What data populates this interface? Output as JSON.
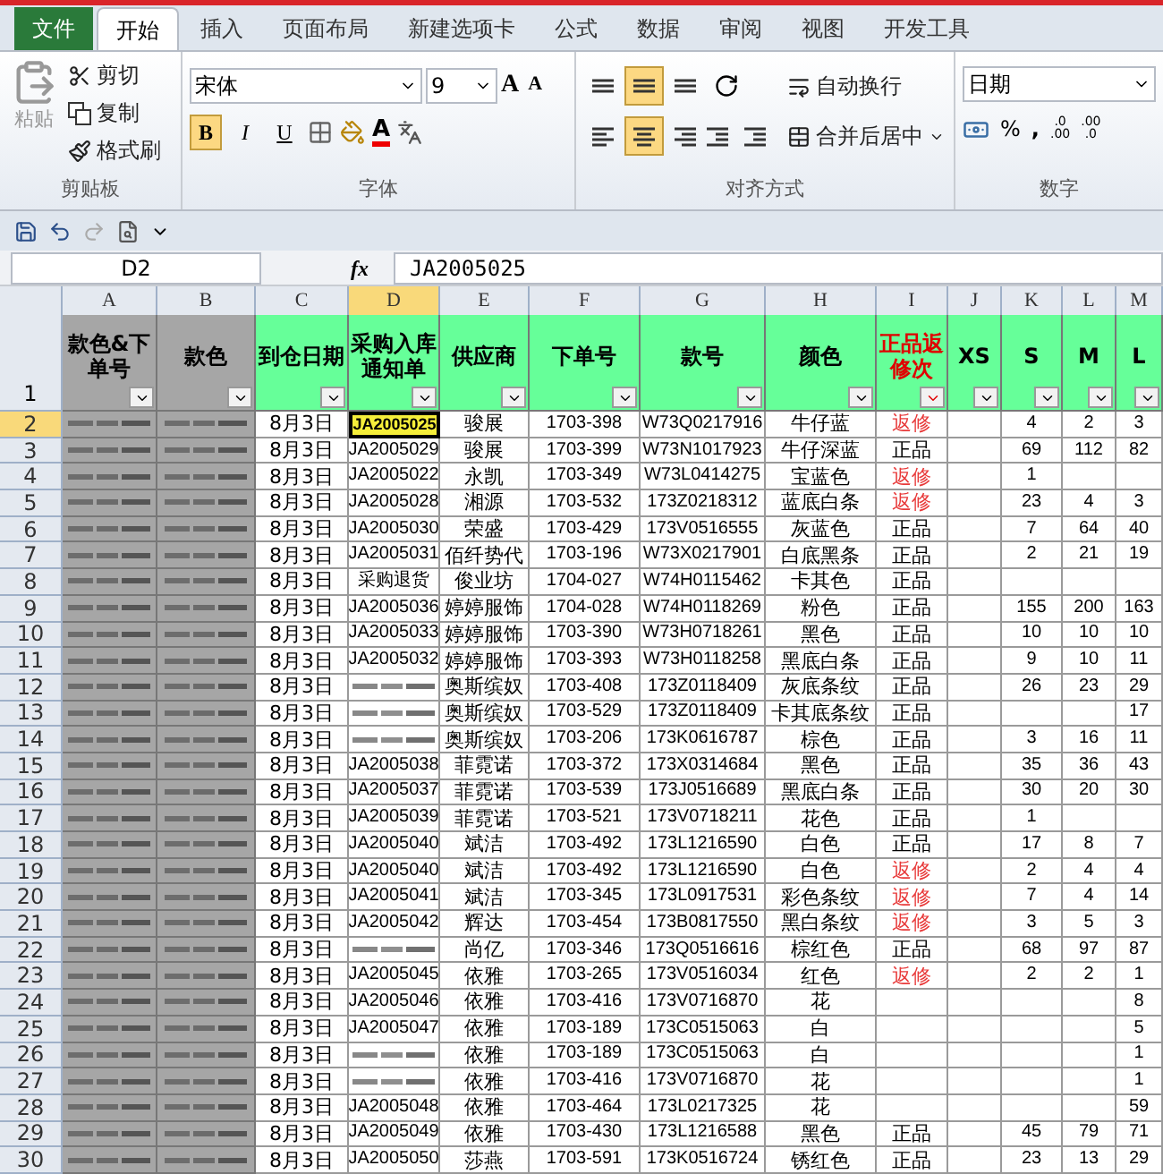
{
  "tabs": [
    {
      "label": "文件",
      "kind": "file",
      "selected": false
    },
    {
      "label": "开始",
      "kind": "tab",
      "selected": true
    },
    {
      "label": "插入",
      "kind": "tab",
      "selected": false
    },
    {
      "label": "页面布局",
      "kind": "tab",
      "selected": false
    },
    {
      "label": "新建选项卡",
      "kind": "tab",
      "selected": false
    },
    {
      "label": "公式",
      "kind": "tab",
      "selected": false
    },
    {
      "label": "数据",
      "kind": "tab",
      "selected": false
    },
    {
      "label": "审阅",
      "kind": "tab",
      "selected": false
    },
    {
      "label": "视图",
      "kind": "tab",
      "selected": false
    },
    {
      "label": "开发工具",
      "kind": "tab",
      "selected": false
    }
  ],
  "ribbon": {
    "clipboard": {
      "title": "剪贴板",
      "paste": "粘贴",
      "cut": "剪切",
      "copy": "复制",
      "painter": "格式刷"
    },
    "font": {
      "title": "字体",
      "family": "宋体",
      "size": "9",
      "grow": "A",
      "shrink": "A",
      "font_color": "A",
      "styles": [
        {
          "kind": "bold",
          "label": "B",
          "on": true
        },
        {
          "kind": "italic",
          "label": "I",
          "on": false
        },
        {
          "kind": "underline",
          "label": "U",
          "on": false
        }
      ]
    },
    "alignment": {
      "title": "对齐方式",
      "wrap": "自动换行",
      "merge": "合并后居中",
      "buttons": [
        {
          "kind": "top",
          "on": false
        },
        {
          "kind": "middle",
          "on": true
        },
        {
          "kind": "bottom",
          "on": false
        },
        {
          "kind": "left",
          "on": false
        },
        {
          "kind": "center",
          "on": true
        },
        {
          "kind": "right",
          "on": false
        }
      ]
    },
    "number": {
      "title": "数字",
      "format": "日期",
      "percent": "%",
      "comma": ",",
      "increase_decimal": [
        ".0",
        ".00"
      ],
      "decrease_decimal": [
        ".00",
        ".0"
      ]
    }
  },
  "formula_bar": {
    "name_box": "D2",
    "fx": "fx",
    "value": "JA2005025"
  },
  "columns": [
    {
      "letter": "A",
      "selected": false
    },
    {
      "letter": "B",
      "selected": false
    },
    {
      "letter": "C",
      "selected": false
    },
    {
      "letter": "D",
      "selected": true
    },
    {
      "letter": "E",
      "selected": false
    },
    {
      "letter": "F",
      "selected": false
    },
    {
      "letter": "G",
      "selected": false
    },
    {
      "letter": "H",
      "selected": false
    },
    {
      "letter": "I",
      "selected": false
    },
    {
      "letter": "J",
      "selected": false
    },
    {
      "letter": "K",
      "selected": false
    },
    {
      "letter": "L",
      "selected": false
    },
    {
      "letter": "M",
      "selected": false
    }
  ],
  "header_row": {
    "number": "1",
    "cells": [
      {
        "label": "款色&下单号",
        "color": "#a6a6a6",
        "alert": false
      },
      {
        "label": "款色",
        "color": "#a6a6a6",
        "alert": false
      },
      {
        "label": "到仓日期",
        "color": "#66ff99",
        "alert": false
      },
      {
        "label": "采购入库通知单",
        "color": "#66ff99",
        "alert": false
      },
      {
        "label": "供应商",
        "color": "#66ff99",
        "alert": false
      },
      {
        "label": "下单号",
        "color": "#66ff99",
        "alert": false
      },
      {
        "label": "款号",
        "color": "#66ff99",
        "alert": false
      },
      {
        "label": "颜色",
        "color": "#66ff99",
        "alert": false
      },
      {
        "label": "正品返修次",
        "color": "#66ff99",
        "alert": true
      },
      {
        "label": "XS",
        "color": "#66ff99",
        "alert": false
      },
      {
        "label": "S",
        "color": "#66ff99",
        "alert": false
      },
      {
        "label": "M",
        "color": "#66ff99",
        "alert": false
      },
      {
        "label": "L",
        "color": "#66ff99",
        "alert": false
      }
    ]
  },
  "rows": [
    {
      "n": "2",
      "selected": true,
      "date": "8月3日",
      "notice": "JA2005025",
      "supplier": "骏展",
      "order": "1703-398",
      "style": "W73Q0217916",
      "color_name": "牛仔蓝",
      "status": "返修",
      "flagged": true,
      "s": "4",
      "m": "2",
      "l": "3"
    },
    {
      "n": "3",
      "selected": false,
      "date": "8月3日",
      "notice": "JA2005029",
      "supplier": "骏展",
      "order": "1703-399",
      "style": "W73N1017923",
      "color_name": "牛仔深蓝",
      "status": "正品",
      "flagged": false,
      "s": "69",
      "m": "112",
      "l": "82"
    },
    {
      "n": "4",
      "selected": false,
      "date": "8月3日",
      "notice": "JA2005022",
      "supplier": "永凯",
      "order": "1703-349",
      "style": "W73L0414275",
      "color_name": "宝蓝色",
      "status": "返修",
      "flagged": true,
      "s": "1"
    },
    {
      "n": "5",
      "selected": false,
      "date": "8月3日",
      "notice": "JA2005028",
      "supplier": "湘源",
      "order": "1703-532",
      "style": "173Z0218312",
      "color_name": "蓝底白条",
      "status": "返修",
      "flagged": true,
      "s": "23",
      "m": "4",
      "l": "3"
    },
    {
      "n": "6",
      "selected": false,
      "date": "8月3日",
      "notice": "JA2005030",
      "supplier": "荣盛",
      "order": "1703-429",
      "style": "173V0516555",
      "color_name": "灰蓝色",
      "status": "正品",
      "flagged": false,
      "s": "7",
      "m": "64",
      "l": "40"
    },
    {
      "n": "7",
      "selected": false,
      "date": "8月3日",
      "notice": "JA2005031",
      "supplier": "佰纤势代",
      "order": "1703-196",
      "style": "W73X0217901",
      "color_name": "白底黑条",
      "status": "正品",
      "flagged": false,
      "s": "2",
      "m": "21",
      "l": "19"
    },
    {
      "n": "8",
      "selected": false,
      "date": "8月3日",
      "notice": "采购退货",
      "supplier": "俊业坊",
      "order": "1704-027",
      "style": "W74H0115462",
      "color_name": "卡其色",
      "status": "正品",
      "flagged": false
    },
    {
      "n": "9",
      "selected": false,
      "date": "8月3日",
      "notice": "JA2005036",
      "supplier": "婷婷服饰",
      "order": "1704-028",
      "style": "W74H0118269",
      "color_name": "粉色",
      "status": "正品",
      "flagged": false,
      "s": "155",
      "m": "200",
      "l": "163"
    },
    {
      "n": "10",
      "selected": false,
      "date": "8月3日",
      "notice": "JA2005033",
      "supplier": "婷婷服饰",
      "order": "1703-390",
      "style": "W73H0718261",
      "color_name": "黑色",
      "status": "正品",
      "flagged": false,
      "s": "10",
      "m": "10",
      "l": "10"
    },
    {
      "n": "11",
      "selected": false,
      "date": "8月3日",
      "notice": "JA2005032",
      "supplier": "婷婷服饰",
      "order": "1703-393",
      "style": "W73H0118258",
      "color_name": "黑底白条",
      "status": "正品",
      "flagged": false,
      "s": "9",
      "m": "10",
      "l": "11"
    },
    {
      "n": "12",
      "selected": false,
      "date": "8月3日",
      "notice_blurred": true,
      "supplier": "奥斯缤奴",
      "order": "1703-408",
      "style": "173Z0118409",
      "color_name": "灰底条纹",
      "status": "正品",
      "flagged": false,
      "s": "26",
      "m": "23",
      "l": "29"
    },
    {
      "n": "13",
      "selected": false,
      "date": "8月3日",
      "notice_blurred": true,
      "supplier": "奥斯缤奴",
      "order": "1703-529",
      "style": "173Z0118409",
      "color_name": "卡其底条纹",
      "status": "正品",
      "flagged": false,
      "l": "17"
    },
    {
      "n": "14",
      "selected": false,
      "date": "8月3日",
      "notice_blurred": true,
      "supplier": "奥斯缤奴",
      "order": "1703-206",
      "style": "173K0616787",
      "color_name": "棕色",
      "status": "正品",
      "flagged": false,
      "s": "3",
      "m": "16",
      "l": "11"
    },
    {
      "n": "15",
      "selected": false,
      "date": "8月3日",
      "notice": "JA2005038",
      "supplier": "菲霓诺",
      "order": "1703-372",
      "style": "173X0314684",
      "color_name": "黑色",
      "status": "正品",
      "flagged": false,
      "s": "35",
      "m": "36",
      "l": "43"
    },
    {
      "n": "16",
      "selected": false,
      "date": "8月3日",
      "notice": "JA2005037",
      "supplier": "菲霓诺",
      "order": "1703-539",
      "style": "173J0516689",
      "color_name": "黑底白条",
      "status": "正品",
      "flagged": false,
      "s": "30",
      "m": "20",
      "l": "30"
    },
    {
      "n": "17",
      "selected": false,
      "date": "8月3日",
      "notice": "JA2005039",
      "supplier": "菲霓诺",
      "order": "1703-521",
      "style": "173V0718211",
      "color_name": "花色",
      "status": "正品",
      "flagged": false,
      "s": "1"
    },
    {
      "n": "18",
      "selected": false,
      "date": "8月3日",
      "notice": "JA2005040",
      "supplier": "斌洁",
      "order": "1703-492",
      "style": "173L1216590",
      "color_name": "白色",
      "status": "正品",
      "flagged": false,
      "s": "17",
      "m": "8",
      "l": "7"
    },
    {
      "n": "19",
      "selected": false,
      "date": "8月3日",
      "notice": "JA2005040",
      "supplier": "斌洁",
      "order": "1703-492",
      "style": "173L1216590",
      "color_name": "白色",
      "status": "返修",
      "flagged": true,
      "s": "2",
      "m": "4",
      "l": "4"
    },
    {
      "n": "20",
      "selected": false,
      "date": "8月3日",
      "notice": "JA2005041",
      "supplier": "斌洁",
      "order": "1703-345",
      "style": "173L0917531",
      "color_name": "彩色条纹",
      "status": "返修",
      "flagged": true,
      "s": "7",
      "m": "4",
      "l": "14"
    },
    {
      "n": "21",
      "selected": false,
      "date": "8月3日",
      "notice": "JA2005042",
      "supplier": "辉达",
      "order": "1703-454",
      "style": "173B0817550",
      "color_name": "黑白条纹",
      "status": "返修",
      "flagged": true,
      "s": "3",
      "m": "5",
      "l": "3"
    },
    {
      "n": "22",
      "selected": false,
      "date": "8月3日",
      "notice_blurred": true,
      "supplier": "尚亿",
      "order": "1703-346",
      "style": "173Q0516616",
      "color_name": "棕红色",
      "status": "正品",
      "flagged": false,
      "s": "68",
      "m": "97",
      "l": "87"
    },
    {
      "n": "23",
      "selected": false,
      "date": "8月3日",
      "notice": "JA2005045",
      "supplier": "依雅",
      "order": "1703-265",
      "style": "173V0516034",
      "color_name": "红色",
      "status": "返修",
      "flagged": true,
      "s": "2",
      "m": "2",
      "l": "1"
    },
    {
      "n": "24",
      "selected": false,
      "date": "8月3日",
      "notice": "JA2005046",
      "supplier": "依雅",
      "order": "1703-416",
      "style": "173V0716870",
      "color_name": "花",
      "l": "8"
    },
    {
      "n": "25",
      "selected": false,
      "date": "8月3日",
      "notice": "JA2005047",
      "supplier": "依雅",
      "order": "1703-189",
      "style": "173C0515063",
      "color_name": "白",
      "l": "5"
    },
    {
      "n": "26",
      "selected": false,
      "date": "8月3日",
      "notice_blurred": true,
      "supplier": "依雅",
      "order": "1703-189",
      "style": "173C0515063",
      "color_name": "白",
      "l": "1"
    },
    {
      "n": "27",
      "selected": false,
      "date": "8月3日",
      "notice_blurred": true,
      "supplier": "依雅",
      "order": "1703-416",
      "style": "173V0716870",
      "color_name": "花",
      "l": "1"
    },
    {
      "n": "28",
      "selected": false,
      "date": "8月3日",
      "notice": "JA2005048",
      "supplier": "依雅",
      "order": "1703-464",
      "style": "173L0217325",
      "color_name": "花",
      "l": "59"
    },
    {
      "n": "29",
      "selected": false,
      "date": "8月3日",
      "notice": "JA2005049",
      "supplier": "依雅",
      "order": "1703-430",
      "style": "173L1216588",
      "color_name": "黑色",
      "status": "正品",
      "flagged": false,
      "s": "45",
      "m": "79",
      "l": "71"
    },
    {
      "n": "30",
      "selected": false,
      "date": "8月3日",
      "notice": "JA2005050",
      "supplier": "莎燕",
      "order": "1703-591",
      "style": "173K0516724",
      "color_name": "锈红色",
      "status": "正品",
      "flagged": false,
      "s": "23",
      "m": "13",
      "l": "29"
    }
  ]
}
